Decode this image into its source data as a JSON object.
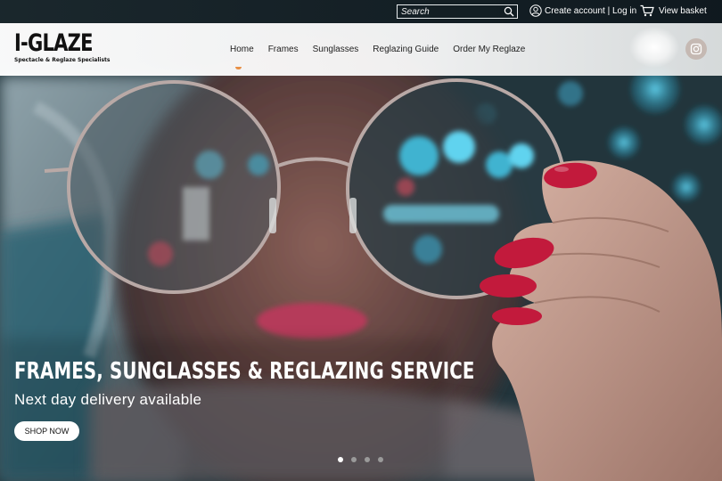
{
  "utility": {
    "search_placeholder": "Search",
    "account_label": "Create account | Log in",
    "basket_label": "View basket"
  },
  "header": {
    "logo_title": "I-GLAZE",
    "logo_subtitle": "Spectacle & Reglaze Specialists",
    "nav": [
      {
        "label": "Home"
      },
      {
        "label": "Frames"
      },
      {
        "label": "Sunglasses"
      },
      {
        "label": "Reglazing Guide"
      },
      {
        "label": "Order My Reglaze"
      }
    ],
    "social_icon": "instagram-icon"
  },
  "hero": {
    "title": "FRAMES, SUNGLASSES & REGLAZING SERVICE",
    "subtitle": "Next day delivery available",
    "cta_label": "SHOP NOW",
    "slides_total": 4,
    "slide_active": 1
  },
  "colors": {
    "accent": "#e88f45",
    "nail": "#c21a3c",
    "lens_glow": "#3fb3d0"
  }
}
